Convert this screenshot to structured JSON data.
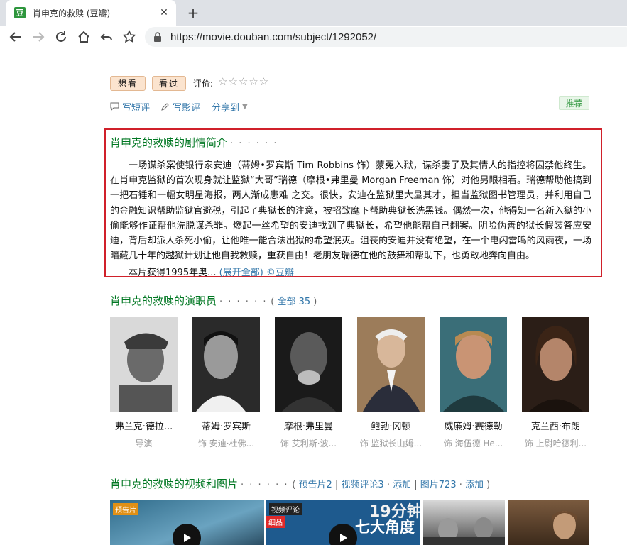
{
  "browser": {
    "tab_title": "肖申克的救赎 (豆瓣)",
    "favicon_text": "豆",
    "url": "https://movie.douban.com/subject/1292052/"
  },
  "actions": {
    "want_label": "想看",
    "seen_label": "看过",
    "rate_label": "评价:",
    "stars": "☆☆☆☆☆",
    "short_review": "写短评",
    "write_review": "写影评",
    "share": "分享到",
    "recommend": "推荐"
  },
  "intro": {
    "title": "肖申克的救赎的剧情简介",
    "dots": "· · · · · ·",
    "text": "一场谋杀案使银行家安迪（蒂姆•罗宾斯 Tim Robbins 饰）蒙冤入狱，谋杀妻子及其情人的指控将囚禁他终生。在肖申克监狱的首次现身就让监狱“大哥”瑞德（摩根•弗里曼 Morgan Freeman 饰）对他另眼相看。瑞德帮助他搞到一把石锤和一幅女明星海报，两人渐成患难 之交。很快，安迪在监狱里大显其才，担当监狱图书管理员，并利用自己的金融知识帮助监狱官避税，引起了典狱长的注意，被招致麾下帮助典狱长洗黑钱。偶然一次，他得知一名新入狱的小偷能够作证帮他洗脱谋杀罪。燃起一丝希望的安迪找到了典狱长，希望他能帮自己翻案。阴险伪善的狱长假装答应安迪，背后却派人杀死小偷，让他唯一能合法出狱的希望泯灭。沮丧的安迪并没有绝望，在一个电闪雷鸣的风雨夜，一场暗藏几十年的越狱计划让他自我救赎，重获自由！老朋友瑞德在他的鼓舞和帮助下，也勇敢地奔向自由。",
    "more_prefix": "本片获得1995年奥...",
    "expand": "(展开全部)",
    "copyright": "©豆瓣"
  },
  "cast_section": {
    "title": "肖申克的救赎的演职员",
    "dots": "· · · · · ·",
    "all_link": "全部 35",
    "members": [
      {
        "name": "弗兰克·德拉...",
        "role": "导演"
      },
      {
        "name": "蒂姆·罗宾斯",
        "role": "饰 安迪·杜佛..."
      },
      {
        "name": "摩根·弗里曼",
        "role": "饰 艾利斯·波..."
      },
      {
        "name": "鲍勃·冈顿",
        "role": "饰 监狱长山姆..."
      },
      {
        "name": "威廉姆·赛德勒",
        "role": "饰 海伍德 He..."
      },
      {
        "name": "克兰西·布朗",
        "role": "饰 上尉哈德利..."
      }
    ]
  },
  "media_section": {
    "title": "肖申克的救赎的视频和图片",
    "dots": "· · · · · ·",
    "trailer_link": "预告片2",
    "video_review_link": "视频评论3",
    "add1": "添加",
    "photos_link": "图片723",
    "add2": "添加",
    "tag_trailer": "预告片",
    "tag_video_review": "视频评论",
    "thumb2_overlay": "19分钟",
    "thumb2_sub": "七大角度",
    "thumb2_badge": "细品"
  },
  "colors": {
    "green_title": "#007722",
    "link": "#3377aa",
    "highlight_border": "#d0202a"
  }
}
